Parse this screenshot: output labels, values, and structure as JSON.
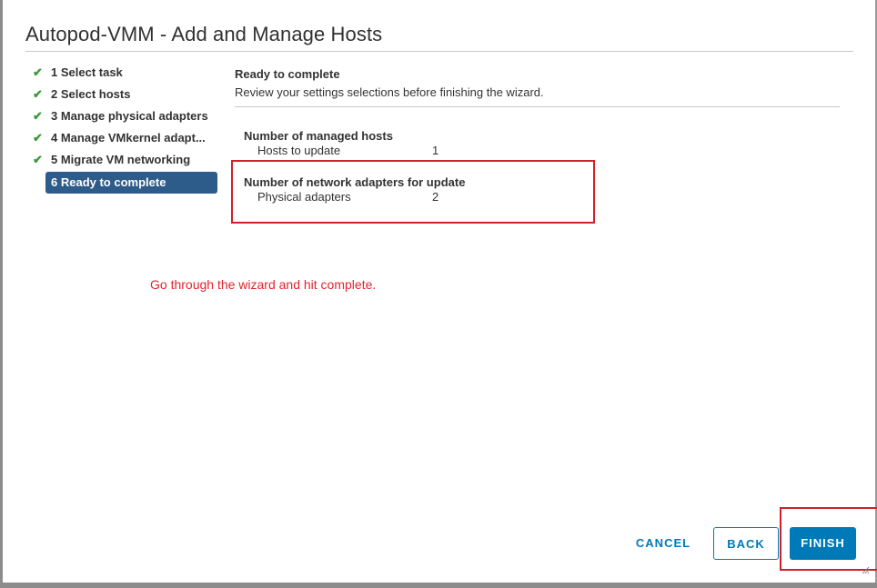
{
  "dialog": {
    "title": "Autopod-VMM - Add and Manage Hosts"
  },
  "nav": {
    "items": [
      {
        "label": "1 Select task",
        "completed": true
      },
      {
        "label": "2 Select hosts",
        "completed": true
      },
      {
        "label": "3 Manage physical adapters",
        "completed": true
      },
      {
        "label": "4 Manage VMkernel adapt...",
        "completed": true
      },
      {
        "label": "5 Migrate VM networking",
        "completed": true
      },
      {
        "label": "6 Ready to complete",
        "completed": false,
        "active": true
      }
    ],
    "check_icon": "✔"
  },
  "content": {
    "title": "Ready to complete",
    "description": "Review your settings selections before finishing the wizard."
  },
  "summary": {
    "sections": [
      {
        "heading": "Number of managed hosts",
        "rows": [
          {
            "label": "Hosts to update",
            "value": "1"
          }
        ]
      },
      {
        "heading": "Number of network adapters for update",
        "rows": [
          {
            "label": "Physical adapters",
            "value": "2"
          }
        ]
      }
    ]
  },
  "annotation": {
    "text": "Go through the wizard and hit complete.",
    "color": "#e0262e"
  },
  "buttons": {
    "cancel": "CANCEL",
    "back": "BACK",
    "finish": "FINISH"
  },
  "colors": {
    "accent": "#0079b8",
    "active_nav": "#2e5c8a",
    "check": "#3c9a3c",
    "highlight_box": "#d11f2a"
  }
}
